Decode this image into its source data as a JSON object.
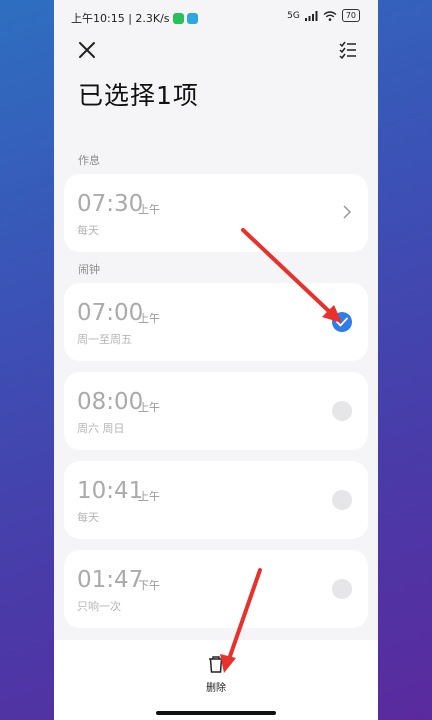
{
  "status_bar": {
    "time_speed": "上午10:15 | 2.3K/s",
    "network": "5G",
    "battery": "70"
  },
  "page": {
    "title": "已选择1项"
  },
  "sections": {
    "rest": "作息",
    "alarm": "闹钟"
  },
  "rest_card": {
    "time": "07:30",
    "ampm": "上午",
    "repeat": "每天"
  },
  "alarms": [
    {
      "time": "07:00",
      "ampm": "上午",
      "repeat": "周一至周五",
      "selected": true
    },
    {
      "time": "08:00",
      "ampm": "上午",
      "repeat": "周六 周日",
      "selected": false
    },
    {
      "time": "10:41",
      "ampm": "上午",
      "repeat": "每天",
      "selected": false
    },
    {
      "time": "01:47",
      "ampm": "下午",
      "repeat": "只响一次",
      "selected": false
    }
  ],
  "bottom": {
    "delete_label": "删除"
  },
  "colors": {
    "accent": "#2f7de8",
    "annotation": "#e8312a"
  }
}
